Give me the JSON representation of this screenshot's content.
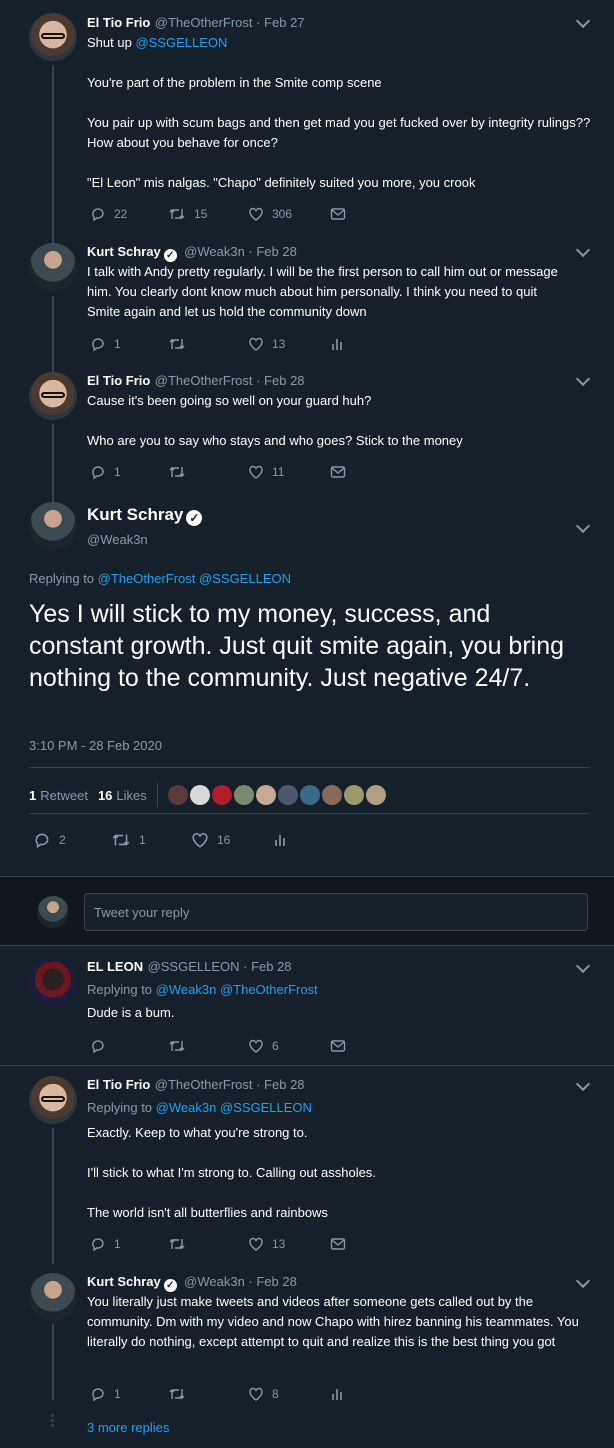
{
  "tweets": [
    {
      "name": "El Tio Frio",
      "meta": "@TheOtherFrost · Feb 27",
      "text_prefix": "Shut up ",
      "text_link": "@SSGELLEON",
      "body": "You're part of the problem in the Smite comp scene\n\nYou pair up with scum bags and then get mad you get fucked over by integrity rulings?? How about you behave for once?\n\n\"El Leon\" mis nalgas. \"Chapo\" definitely suited you more, you crook",
      "replies": "22",
      "retweets": "15",
      "likes": "306"
    },
    {
      "name": "Kurt Schray",
      "meta": "@Weak3n · Feb 28",
      "body": "I talk with Andy pretty regularly. I will be the first person to call him out or message him. You clearly dont know much about him personally. I think you need to quit Smite again and let us hold the community down",
      "replies": "1",
      "retweets": "",
      "likes": "13"
    },
    {
      "name": "El Tio Frio",
      "meta": "@TheOtherFrost · Feb 28",
      "body": "Cause it's been going so well on your guard huh?\n\nWho are you to say who stays and who goes? Stick to the money",
      "replies": "1",
      "retweets": "",
      "likes": "11"
    }
  ],
  "main": {
    "name": "Kurt Schray",
    "handle": "@Weak3n",
    "replying_to_label": "Replying to",
    "replying_to_1": "@TheOtherFrost",
    "replying_to_2": "@SSGELLEON",
    "body": "Yes I will stick to my money, success, and constant growth. Just quit smite again, you bring nothing to the community. Just negative 24/7.",
    "timestamp": "3:10 PM - 28 Feb 2020",
    "retweet_count": "1",
    "retweet_label": "Retweet",
    "like_count": "16",
    "like_label": "Likes",
    "replies": "2",
    "retweets": "1",
    "likes": "16"
  },
  "reply_box": {
    "placeholder": "Tweet your reply"
  },
  "replies": [
    {
      "name": "EL LEON",
      "meta": "@SSGELLEON · Feb 28",
      "replying_label": "Replying to",
      "replying_1": "@Weak3n",
      "replying_2": "@TheOtherFrost",
      "body": "Dude is a bum.",
      "replies": "",
      "retweets": "",
      "likes": "6"
    },
    {
      "name": "El Tio Frio",
      "meta": "@TheOtherFrost · Feb 28",
      "replying_label": "Replying to",
      "replying_1": "@Weak3n",
      "replying_2": "@SSGELLEON",
      "body": "Exactly. Keep to what you're strong to.\n\nI'll stick to what I'm strong to. Calling out assholes.\n\nThe world isn't all butterflies and rainbows",
      "replies": "1",
      "retweets": "",
      "likes": "13"
    },
    {
      "name": "Kurt Schray",
      "meta": "@Weak3n · Feb 28",
      "body": "You literally just make tweets and videos after someone gets called out by the community. Dm with my video and now Chapo with hirez banning his teammates. You literally do nothing, except attempt to quit and realize this is the best thing you got",
      "replies": "1",
      "retweets": "",
      "likes": "8"
    }
  ],
  "more_replies": "3 more replies",
  "colors": {
    "background": "#15202b",
    "accent": "#1da1f2",
    "muted": "#8899a6",
    "border": "#38444d"
  }
}
